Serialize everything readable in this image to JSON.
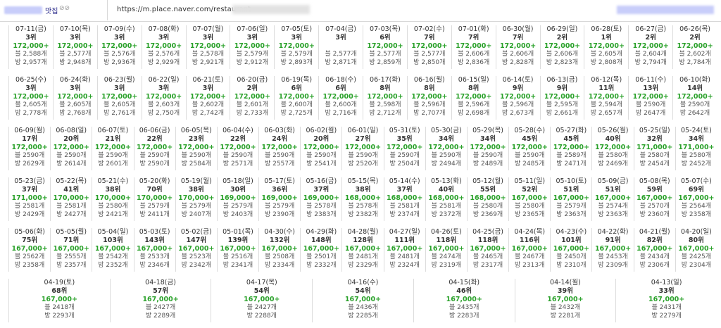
{
  "header": {
    "tab_title": "맛집",
    "tab_badge": "⊘⊘",
    "url": "https://m.place.naver.com/restaurant"
  },
  "cells": [
    {
      "date": "07-11(금)",
      "rank": "3위",
      "price": "172,000+",
      "blog": "블 2,588개",
      "visit": "방 2,957개"
    },
    {
      "date": "07-10(목)",
      "rank": "3위",
      "price": "172,000+",
      "blog": "블 2,577개",
      "visit": "방 2,948개"
    },
    {
      "date": "07-09(수)",
      "rank": "3위",
      "price": "172,000+",
      "blog": "블 2,576개",
      "visit": "방 2,936개"
    },
    {
      "date": "07-08(화)",
      "rank": "3위",
      "price": "172,000+",
      "blog": "블 2,576개",
      "visit": "방 2,929개"
    },
    {
      "date": "07-07(월)",
      "rank": "3위",
      "price": "172,000+",
      "blog": "블 2,578개",
      "visit": "방 2,921개"
    },
    {
      "date": "07-06(일)",
      "rank": "3위",
      "price": "172,000+",
      "blog": "블 2,579개",
      "visit": "방 2,912개"
    },
    {
      "date": "07-05(토)",
      "rank": "3위",
      "price": "172,000+",
      "blog": "블 2,579개",
      "visit": "방 2,893개"
    },
    {
      "date": "07-04(금)",
      "rank": "3위",
      "price": "",
      "blog": "블 2,577개",
      "visit": "방 2,871개"
    },
    {
      "date": "07-03(목)",
      "rank": "6위",
      "price": "172,000+",
      "blog": "블 2,577개",
      "visit": "방 2,859개"
    },
    {
      "date": "07-02(수)",
      "rank": "7위",
      "price": "172,000+",
      "blog": "블 2,577개",
      "visit": "방 2,850개"
    },
    {
      "date": "07-01(화)",
      "rank": "7위",
      "price": "172,000+",
      "blog": "블 2,606개",
      "visit": "방 2,836개"
    },
    {
      "date": "06-30(월)",
      "rank": "7위",
      "price": "172,000+",
      "blog": "블 2,606개",
      "visit": "방 2,828개"
    },
    {
      "date": "06-29(일)",
      "rank": "2위",
      "price": "172,000+",
      "blog": "블 2,606개",
      "visit": "방 2,823개"
    },
    {
      "date": "06-28(토)",
      "rank": "1위",
      "price": "172,000+",
      "blog": "블 2,605개",
      "visit": "방 2,808개"
    },
    {
      "date": "06-27(금)",
      "rank": "2위",
      "price": "172,000+",
      "blog": "블 2,604개",
      "visit": "방 2,794개"
    },
    {
      "date": "06-26(목)",
      "rank": "2위",
      "price": "172,000+",
      "blog": "블 2,602개",
      "visit": "방 2,784개"
    },
    {
      "date": "06-25(수)",
      "rank": "3위",
      "price": "172,000+",
      "blog": "블 2,605개",
      "visit": "방 2,778개"
    },
    {
      "date": "06-24(화)",
      "rank": "3위",
      "price": "172,000+",
      "blog": "블 2,605개",
      "visit": "방 2,768개"
    },
    {
      "date": "06-23(월)",
      "rank": "3위",
      "price": "172,000+",
      "blog": "블 2,605개",
      "visit": "방 2,761개"
    },
    {
      "date": "06-22(일)",
      "rank": "3위",
      "price": "172,000+",
      "blog": "블 2,603개",
      "visit": "방 2,750개"
    },
    {
      "date": "06-21(토)",
      "rank": "3위",
      "price": "172,000+",
      "blog": "블 2,602개",
      "visit": "방 2,742개"
    },
    {
      "date": "06-20(금)",
      "rank": "2위",
      "price": "172,000+",
      "blog": "블 2,601개",
      "visit": "방 2,733개"
    },
    {
      "date": "06-19(목)",
      "rank": "6위",
      "price": "172,000+",
      "blog": "블 2,600개",
      "visit": "방 2,725개"
    },
    {
      "date": "06-18(수)",
      "rank": "6위",
      "price": "172,000+",
      "blog": "블 2,600개",
      "visit": "방 2,716개"
    },
    {
      "date": "06-17(화)",
      "rank": "8위",
      "price": "172,000+",
      "blog": "블 2,598개",
      "visit": "방 2,712개"
    },
    {
      "date": "06-16(월)",
      "rank": "8위",
      "price": "172,000+",
      "blog": "블 2,596개",
      "visit": "방 2,707개"
    },
    {
      "date": "06-15(일)",
      "rank": "8위",
      "price": "172,000+",
      "blog": "블 2,596개",
      "visit": "방 2,698개"
    },
    {
      "date": "06-14(토)",
      "rank": "9위",
      "price": "172,000+",
      "blog": "블 2,596개",
      "visit": "방 2,673개"
    },
    {
      "date": "06-13(금)",
      "rank": "9위",
      "price": "172,000+",
      "blog": "블 2,595개",
      "visit": "방 2,661개"
    },
    {
      "date": "06-12(목)",
      "rank": "11위",
      "price": "172,000+",
      "blog": "블 2,594개",
      "visit": "방 2,657개"
    },
    {
      "date": "06-11(수)",
      "rank": "13위",
      "price": "172,000+",
      "blog": "블 2590개",
      "visit": "방 2647개"
    },
    {
      "date": "06-10(화)",
      "rank": "14위",
      "price": "172,000+",
      "blog": "블 2590개",
      "visit": "방 2642개"
    },
    {
      "date": "06-09(월)",
      "rank": "17위",
      "price": "172,000+",
      "blog": "블 2590개",
      "visit": "방 2629개"
    },
    {
      "date": "06-08(일)",
      "rank": "20위",
      "price": "172,000+",
      "blog": "블 2590개",
      "visit": "방 2614개"
    },
    {
      "date": "06-07(토)",
      "rank": "21위",
      "price": "172,000+",
      "blog": "블 2590개",
      "visit": "방 2601개"
    },
    {
      "date": "06-06(금)",
      "rank": "22위",
      "price": "172,000+",
      "blog": "블 2590개",
      "visit": "방 2590개"
    },
    {
      "date": "06-05(목)",
      "rank": "23위",
      "price": "172,000+",
      "blog": "블 2590개",
      "visit": "방 2584개"
    },
    {
      "date": "06-04(수)",
      "rank": "22위",
      "price": "172,000+",
      "blog": "블 2590개",
      "visit": "방 2571개"
    },
    {
      "date": "06-03(화)",
      "rank": "24위",
      "price": "172,000+",
      "blog": "블 2590개",
      "visit": "방 2557개"
    },
    {
      "date": "06-02(월)",
      "rank": "20위",
      "price": "172,000+",
      "blog": "블 2590개",
      "visit": "방 2541개"
    },
    {
      "date": "06-01(일)",
      "rank": "27위",
      "price": "172,000+",
      "blog": "블 2590개",
      "visit": "방 2520개"
    },
    {
      "date": "05-31(토)",
      "rank": "35위",
      "price": "172,000+",
      "blog": "블 2590개",
      "visit": "방 2504개"
    },
    {
      "date": "05-30(금)",
      "rank": "34위",
      "price": "172,000+",
      "blog": "블 2590개",
      "visit": "방 2494개"
    },
    {
      "date": "05-29(목)",
      "rank": "34위",
      "price": "172,000+",
      "blog": "블 2590개",
      "visit": "방 2489개"
    },
    {
      "date": "05-28(수)",
      "rank": "45위",
      "price": "172,000+",
      "blog": "블 2590개",
      "visit": "방 2485개"
    },
    {
      "date": "05-27(화)",
      "rank": "45위",
      "price": "172,000+",
      "blog": "블 2589개",
      "visit": "방 2471개"
    },
    {
      "date": "05-26(월)",
      "rank": "40위",
      "price": "172,000+",
      "blog": "블 2580개",
      "visit": "방 2469개"
    },
    {
      "date": "05-25(일)",
      "rank": "32위",
      "price": "171,000+",
      "blog": "블 2580개",
      "visit": "방 2454개"
    },
    {
      "date": "05-24(토)",
      "rank": "34위",
      "price": "171,000+",
      "blog": "블 2580개",
      "visit": "방 2452개"
    },
    {
      "date": "05-23(금)",
      "rank": "37위",
      "price": "171,000+",
      "blog": "블 2581개",
      "visit": "방 2429개"
    },
    {
      "date": "05-22(목)",
      "rank": "41위",
      "price": "170,000+",
      "blog": "블 2581개",
      "visit": "방 2427개"
    },
    {
      "date": "05-21(수)",
      "rank": "38위",
      "price": "170,000+",
      "blog": "블 2580개",
      "visit": "방 2421개"
    },
    {
      "date": "05-20(화)",
      "rank": "70위",
      "price": "170,000+",
      "blog": "블 2579개",
      "visit": "방 2411개"
    },
    {
      "date": "05-19(월)",
      "rank": "38위",
      "price": "170,000+",
      "blog": "블 2579개",
      "visit": "방 2407개"
    },
    {
      "date": "05-18(일)",
      "rank": "30위",
      "price": "169,000+",
      "blog": "블 2579개",
      "visit": "방 2403개"
    },
    {
      "date": "05-17(토)",
      "rank": "36위",
      "price": "169,000+",
      "blog": "블 2579개",
      "visit": "방 2390개"
    },
    {
      "date": "05-16(금)",
      "rank": "37위",
      "price": "169,000+",
      "blog": "블 2578개",
      "visit": "방 2383개"
    },
    {
      "date": "05-15(목)",
      "rank": "38위",
      "price": "168,000+",
      "blog": "블 2578개",
      "visit": "방 2382개"
    },
    {
      "date": "05-14(수)",
      "rank": "37위",
      "price": "168,000+",
      "blog": "블 2581개",
      "visit": "방 2374개"
    },
    {
      "date": "05-13(화)",
      "rank": "40위",
      "price": "168,000+",
      "blog": "블 2581개",
      "visit": "방 2372개"
    },
    {
      "date": "05-12(월)",
      "rank": "55위",
      "price": "168,000+",
      "blog": "블 2580개",
      "visit": "방 2369개"
    },
    {
      "date": "05-11(일)",
      "rank": "52위",
      "price": "167,000+",
      "blog": "블 2580개",
      "visit": "방 2365개"
    },
    {
      "date": "05-10(토)",
      "rank": "51위",
      "price": "167,000+",
      "blog": "블 2579개",
      "visit": "방 2363개"
    },
    {
      "date": "05-09(금)",
      "rank": "51위",
      "price": "167,000+",
      "blog": "블 2574개",
      "visit": "방 2363개"
    },
    {
      "date": "05-08(목)",
      "rank": "59위",
      "price": "167,000+",
      "blog": "블 2570개",
      "visit": "방 2360개"
    },
    {
      "date": "05-07(수)",
      "rank": "69위",
      "price": "167,000+",
      "blog": "블 2564개",
      "visit": "방 2358개"
    },
    {
      "date": "05-06(화)",
      "rank": "75위",
      "price": "167,000+",
      "blog": "블 2562개",
      "visit": "방 2358개"
    },
    {
      "date": "05-05(월)",
      "rank": "71위",
      "price": "167,000+",
      "blog": "블 2555개",
      "visit": "방 2357개"
    },
    {
      "date": "05-04(일)",
      "rank": "103위",
      "price": "167,000+",
      "blog": "블 2542개",
      "visit": "방 2352개"
    },
    {
      "date": "05-03(토)",
      "rank": "143위",
      "price": "167,000+",
      "blog": "블 2533개",
      "visit": "방 2346개"
    },
    {
      "date": "05-02(금)",
      "rank": "147위",
      "price": "167,000+",
      "blog": "블 2523개",
      "visit": "방 2342개"
    },
    {
      "date": "05-01(목)",
      "rank": "139위",
      "price": "167,000+",
      "blog": "블 2516개",
      "visit": "방 2341개"
    },
    {
      "date": "04-30(수)",
      "rank": "132위",
      "price": "167,000+",
      "blog": "블 2508개",
      "visit": "방 2334개"
    },
    {
      "date": "04-29(화)",
      "rank": "148위",
      "price": "167,000+",
      "blog": "블 2501개",
      "visit": "방 2332개"
    },
    {
      "date": "04-28(월)",
      "rank": "128위",
      "price": "167,000+",
      "blog": "블 2481개",
      "visit": "방 2329개"
    },
    {
      "date": "04-27(일)",
      "rank": "111위",
      "price": "167,000+",
      "blog": "블 2481개",
      "visit": "방 2324개"
    },
    {
      "date": "04-26(토)",
      "rank": "118위",
      "price": "167,000+",
      "blog": "블 2474개",
      "visit": "방 2319개"
    },
    {
      "date": "04-25(금)",
      "rank": "118위",
      "price": "167,000+",
      "blog": "블 2465개",
      "visit": "방 2317개"
    },
    {
      "date": "04-24(목)",
      "rank": "116위",
      "price": "167,000+",
      "blog": "블 2467개",
      "visit": "방 2313개"
    },
    {
      "date": "04-23(수)",
      "rank": "101위",
      "price": "167,000+",
      "blog": "블 2450개",
      "visit": "방 2310개"
    },
    {
      "date": "04-22(화)",
      "rank": "91위",
      "price": "167,000+",
      "blog": "블 2453개",
      "visit": "방 2309개"
    },
    {
      "date": "04-21(월)",
      "rank": "82위",
      "price": "167,000+",
      "blog": "블 2434개",
      "visit": "방 2306개"
    },
    {
      "date": "04-20(일)",
      "rank": "80위",
      "price": "167,000+",
      "blog": "블 2425개",
      "visit": "방 2304개"
    },
    {
      "date": "04-19(토)",
      "rank": "68위",
      "price": "167,000+",
      "blog": "블 2418개",
      "visit": "방 2293개"
    },
    {
      "date": "04-18(금)",
      "rank": "57위",
      "price": "167,000+",
      "blog": "블 2427개",
      "visit": "방 2289개"
    },
    {
      "date": "04-17(목)",
      "rank": "54위",
      "price": "167,000+",
      "blog": "블 2427개",
      "visit": "방 2288개"
    },
    {
      "date": "04-16(수)",
      "rank": "54위",
      "price": "167,000+",
      "blog": "블 2436개",
      "visit": "방 2285개"
    },
    {
      "date": "04-15(화)",
      "rank": "46위",
      "price": "167,000+",
      "blog": "블 2435개",
      "visit": "방 2283개"
    },
    {
      "date": "04-14(월)",
      "rank": "39위",
      "price": "167,000+",
      "blog": "블 2432개",
      "visit": "방 2281개"
    },
    {
      "date": "04-13(일)",
      "rank": "33위",
      "price": "167,000+",
      "blog": "블 2431개",
      "visit": "방 2279개"
    }
  ]
}
